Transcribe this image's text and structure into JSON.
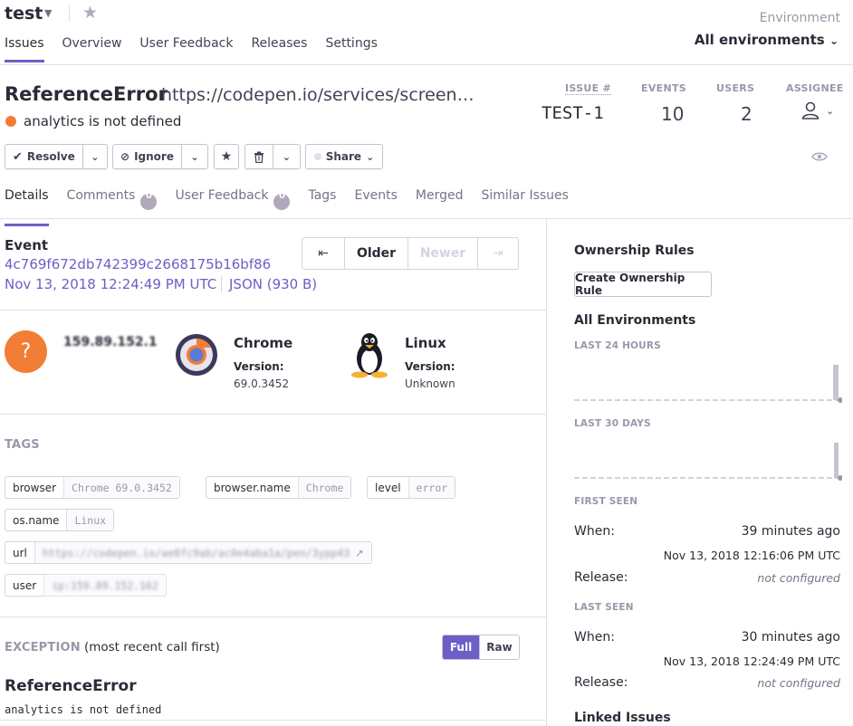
{
  "header": {
    "project": "test",
    "environment_label": "Environment",
    "environment_value": "All environments",
    "nav": [
      "Issues",
      "Overview",
      "User Feedback",
      "Releases",
      "Settings"
    ]
  },
  "issue": {
    "type": "ReferenceError",
    "url": "https://codepen.io/services/screenshot/...",
    "message": "analytics is not defined",
    "stats": {
      "issue_label": "ISSUE #",
      "issue_value": "TEST-1",
      "events_label": "EVENTS",
      "events_value": "10",
      "users_label": "USERS",
      "users_value": "2",
      "assignee_label": "ASSIGNEE"
    }
  },
  "actions": {
    "resolve": "Resolve",
    "ignore": "Ignore",
    "share": "Share"
  },
  "tabs": [
    {
      "label": "Details"
    },
    {
      "label": "Comments",
      "badge": "0"
    },
    {
      "label": "User Feedback",
      "badge": "0"
    },
    {
      "label": "Tags"
    },
    {
      "label": "Events"
    },
    {
      "label": "Merged"
    },
    {
      "label": "Similar Issues"
    }
  ],
  "event": {
    "label": "Event",
    "id": "4c769f672db742399c2668175b16bf86",
    "date": "Nov 13, 2018 12:24:49 PM UTC",
    "json": "JSON (930 B)",
    "older": "Older",
    "newer": "Newer"
  },
  "context": {
    "user_avatar": "?",
    "user_ip": "159.89.152.1",
    "browser_name": "Chrome",
    "browser_version_label": "Version:",
    "browser_version": "69.0.3452",
    "os_name": "Linux",
    "os_version_label": "Version:",
    "os_version": "Unknown"
  },
  "tags_section": {
    "title": "TAGS",
    "tags": [
      {
        "key": "browser",
        "value": "Chrome 69.0.3452"
      },
      {
        "key": "browser.name",
        "value": "Chrome"
      },
      {
        "key": "level",
        "value": "error"
      },
      {
        "key": "os.name",
        "value": "Linux"
      },
      {
        "key": "url",
        "value": "https://codepen.io/ae8fc9ab/ac0e4aba1a/pen/3ypp43"
      },
      {
        "key": "user",
        "value": "ip:159.89.152.162"
      }
    ]
  },
  "exception": {
    "title": "EXCEPTION",
    "subtitle": "(most recent call first)",
    "full": "Full",
    "raw": "Raw",
    "type": "ReferenceError",
    "value": "analytics is not defined"
  },
  "sidebar": {
    "ownership_title": "Ownership Rules",
    "create_rule": "Create Ownership Rule",
    "all_env_title": "All Environments",
    "last24": "LAST 24 HOURS",
    "last30": "LAST 30 DAYS",
    "first_seen": {
      "title": "FIRST SEEN",
      "when_label": "When:",
      "when_value": "39 minutes ago",
      "date": "Nov 13, 2018 12:16:06 PM UTC",
      "release_label": "Release:",
      "release_value": "not configured"
    },
    "last_seen": {
      "title": "LAST SEEN",
      "when_label": "When:",
      "when_value": "30 minutes ago",
      "date": "Nov 13, 2018 12:24:49 PM UTC",
      "release_label": "Release:",
      "release_value": "not configured"
    },
    "linked_issues": "Linked Issues"
  },
  "colors": {
    "accent": "#6c5fc7",
    "error": "#f27d35"
  }
}
